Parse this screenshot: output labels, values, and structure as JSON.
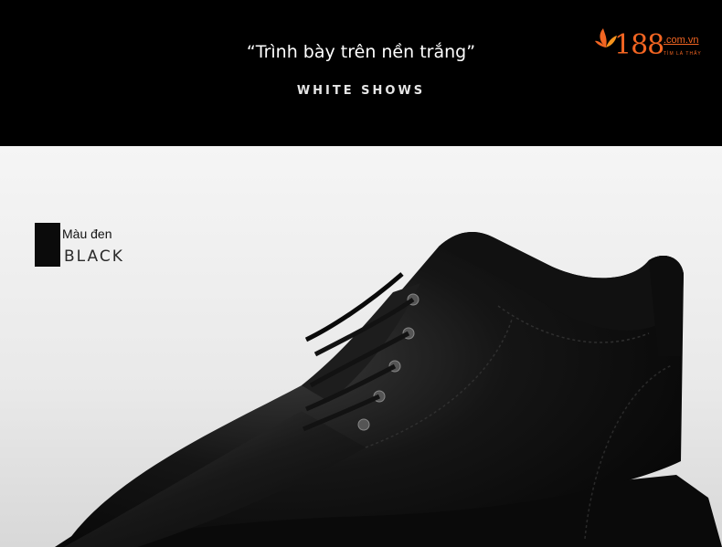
{
  "banner": {
    "headline": "“Trình bày trên nền trắng”",
    "subline": "WHITE SHOWS"
  },
  "logo": {
    "number": "188",
    "domain": ".com.vn",
    "tagline": "TÌM LÀ THẤY",
    "color": "#f26522"
  },
  "product": {
    "color_label": "Màu đen",
    "color_label_en": "BLACK",
    "swatch_color": "#0b0b0b"
  }
}
